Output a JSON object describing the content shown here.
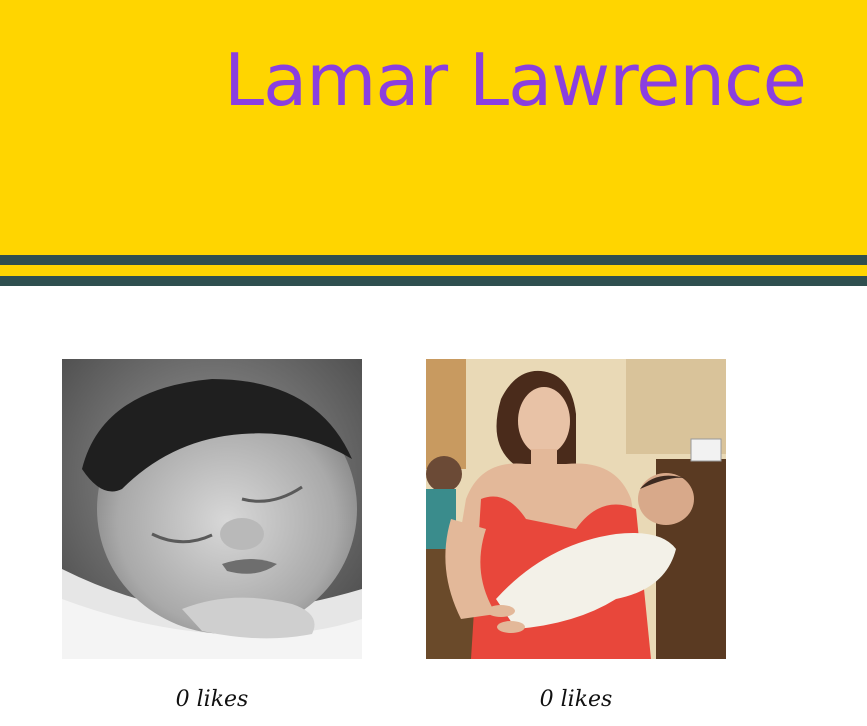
{
  "header": {
    "title": "Lamar Lawrence",
    "background_color": "#ffd500",
    "title_color": "#8a3fe0",
    "stripe_color": "#2f4f4f"
  },
  "gallery": [
    {
      "photo": "sleeping-baby-bw-photo",
      "likes_label": "0 likes"
    },
    {
      "photo": "woman-holding-baby-photo",
      "likes_label": "0 likes"
    }
  ]
}
